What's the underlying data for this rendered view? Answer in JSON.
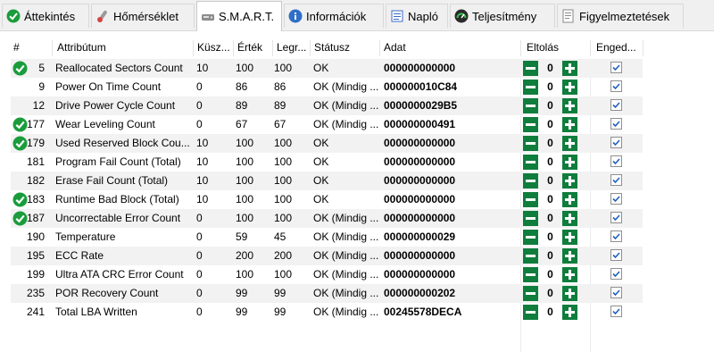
{
  "tabs": [
    {
      "label": "Áttekintés",
      "icon": "checkmark-icon"
    },
    {
      "label": "Hőmérséklet",
      "icon": "thermometer-icon"
    },
    {
      "label": "S.M.A.R.T.",
      "icon": "smart-hdd-icon"
    },
    {
      "label": "Információk",
      "icon": "info-icon"
    },
    {
      "label": "Napló",
      "icon": "log-icon"
    },
    {
      "label": "Teljesítmény",
      "icon": "performance-icon"
    },
    {
      "label": "Figyelmeztetések",
      "icon": "warnings-icon"
    }
  ],
  "active_tab": "S.M.A.R.T.",
  "columns": {
    "num": "#",
    "attribute": "Attribútum",
    "threshold": "Küsz...",
    "value": "Érték",
    "worst": "Legr...",
    "status": "Státusz",
    "data": "Adat",
    "offset": "Eltolás",
    "enabled": "Enged..."
  },
  "rows": [
    {
      "num": "5",
      "attribute": "Reallocated Sectors Count",
      "threshold": "10",
      "value": "100",
      "worst": "100",
      "status": "OK",
      "data": "000000000000",
      "offset": "0",
      "ok_icon": true,
      "enabled": true
    },
    {
      "num": "9",
      "attribute": "Power On Time Count",
      "threshold": "0",
      "value": "86",
      "worst": "86",
      "status": "OK (Mindig ...",
      "data": "000000010C84",
      "offset": "0",
      "ok_icon": false,
      "enabled": true
    },
    {
      "num": "12",
      "attribute": "Drive Power Cycle Count",
      "threshold": "0",
      "value": "89",
      "worst": "89",
      "status": "OK (Mindig ...",
      "data": "0000000029B5",
      "offset": "0",
      "ok_icon": false,
      "enabled": true
    },
    {
      "num": "177",
      "attribute": "Wear Leveling Count",
      "threshold": "0",
      "value": "67",
      "worst": "67",
      "status": "OK (Mindig ...",
      "data": "000000000491",
      "offset": "0",
      "ok_icon": true,
      "enabled": true
    },
    {
      "num": "179",
      "attribute": "Used Reserved Block Cou...",
      "threshold": "10",
      "value": "100",
      "worst": "100",
      "status": "OK",
      "data": "000000000000",
      "offset": "0",
      "ok_icon": true,
      "enabled": true
    },
    {
      "num": "181",
      "attribute": "Program Fail Count (Total)",
      "threshold": "10",
      "value": "100",
      "worst": "100",
      "status": "OK",
      "data": "000000000000",
      "offset": "0",
      "ok_icon": false,
      "enabled": true
    },
    {
      "num": "182",
      "attribute": "Erase Fail Count (Total)",
      "threshold": "10",
      "value": "100",
      "worst": "100",
      "status": "OK",
      "data": "000000000000",
      "offset": "0",
      "ok_icon": false,
      "enabled": true
    },
    {
      "num": "183",
      "attribute": "Runtime Bad Block (Total)",
      "threshold": "10",
      "value": "100",
      "worst": "100",
      "status": "OK",
      "data": "000000000000",
      "offset": "0",
      "ok_icon": true,
      "enabled": true
    },
    {
      "num": "187",
      "attribute": "Uncorrectable Error Count",
      "threshold": "0",
      "value": "100",
      "worst": "100",
      "status": "OK (Mindig ...",
      "data": "000000000000",
      "offset": "0",
      "ok_icon": true,
      "enabled": true
    },
    {
      "num": "190",
      "attribute": "Temperature",
      "threshold": "0",
      "value": "59",
      "worst": "45",
      "status": "OK (Mindig ...",
      "data": "000000000029",
      "offset": "0",
      "ok_icon": false,
      "enabled": true
    },
    {
      "num": "195",
      "attribute": "ECC Rate",
      "threshold": "0",
      "value": "200",
      "worst": "200",
      "status": "OK (Mindig ...",
      "data": "000000000000",
      "offset": "0",
      "ok_icon": false,
      "enabled": true
    },
    {
      "num": "199",
      "attribute": "Ultra ATA CRC Error Count",
      "threshold": "0",
      "value": "100",
      "worst": "100",
      "status": "OK (Mindig ...",
      "data": "000000000000",
      "offset": "0",
      "ok_icon": false,
      "enabled": true
    },
    {
      "num": "235",
      "attribute": "POR Recovery Count",
      "threshold": "0",
      "value": "99",
      "worst": "99",
      "status": "OK (Mindig ...",
      "data": "000000000202",
      "offset": "0",
      "ok_icon": false,
      "enabled": true
    },
    {
      "num": "241",
      "attribute": "Total LBA Written",
      "threshold": "0",
      "value": "99",
      "worst": "99",
      "status": "OK (Mindig ...",
      "data": "00245578DECA",
      "offset": "0",
      "ok_icon": false,
      "enabled": true
    }
  ],
  "colors": {
    "ok_green": "#1a9c3c",
    "button_green": "#0f7d3c",
    "alt_row": "#f2f2f2",
    "check_blue": "#1f5fbf"
  }
}
